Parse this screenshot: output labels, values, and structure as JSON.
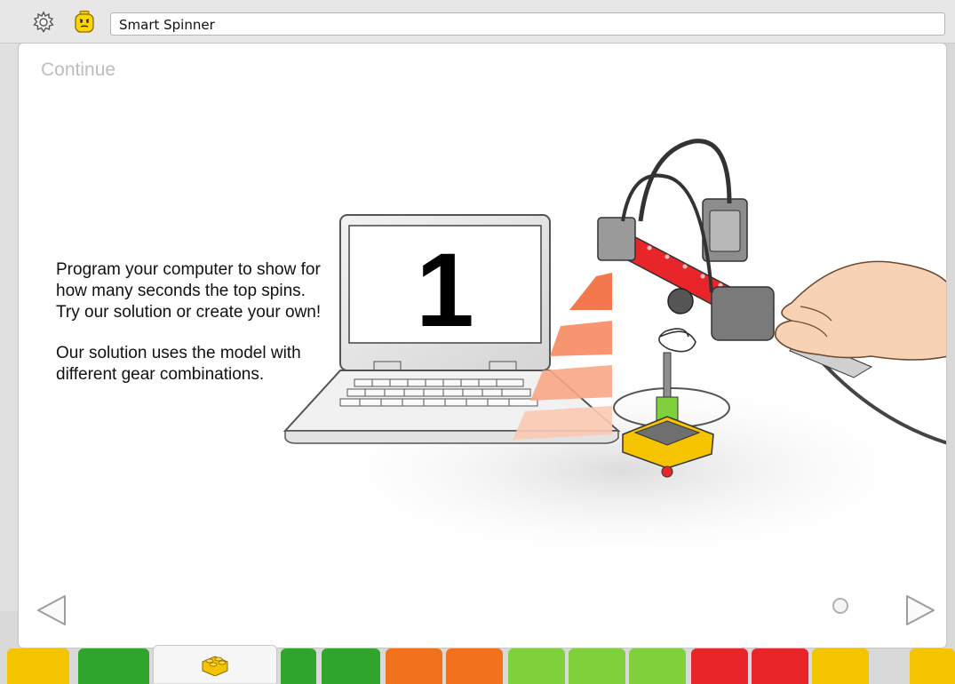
{
  "toolbar": {
    "settings_icon": "gear-icon",
    "profile_icon": "minifigure-face-icon",
    "project_title": "Smart Spinner"
  },
  "page": {
    "heading": "Continue",
    "paragraphs": [
      "Program your computer to show for how many seconds the top spins. Try our solution or create your own!",
      "Our solution uses the model with different gear combinations."
    ],
    "screen_number": "1"
  },
  "navigation": {
    "prev_icon": "triangle-left-icon",
    "next_icon": "triangle-right-icon",
    "page_indicator_icon": "circle-dot-icon"
  },
  "palette": {
    "active_tab_icon": "lego-brick-icon",
    "colors": {
      "yellow": "#f5c400",
      "green": "#2fa52b",
      "orange": "#f2711c",
      "lime": "#7fd13b",
      "red": "#e8262a"
    }
  }
}
